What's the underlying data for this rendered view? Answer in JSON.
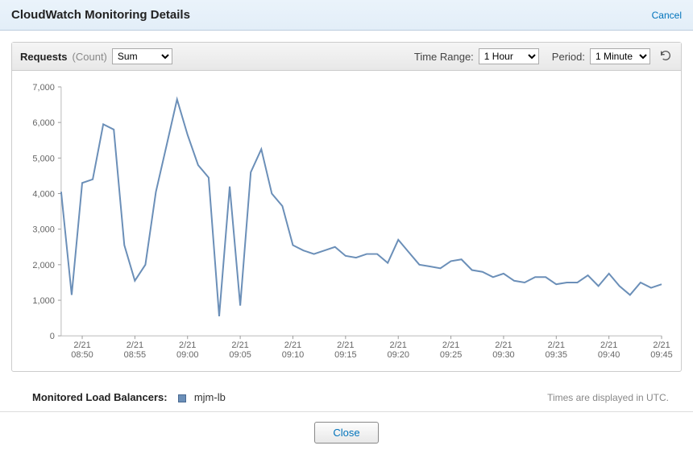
{
  "title": "CloudWatch Monitoring Details",
  "cancel_label": "Cancel",
  "metric": {
    "name": "Requests",
    "unit": "(Count)"
  },
  "toolbar": {
    "stat_selected": "Sum",
    "time_range_label": "Time Range:",
    "time_range_selected": "1 Hour",
    "period_label": "Period:",
    "period_selected": "1 Minute"
  },
  "footer": {
    "lb_label": "Monitored Load Balancers:",
    "lb_name": "mjm-lb",
    "tz_note": "Times are displayed in UTC."
  },
  "close_label": "Close",
  "chart_data": {
    "type": "line",
    "title": "Requests (Count) Sum",
    "xlabel": "",
    "ylabel": "",
    "ylim": [
      0,
      7000
    ],
    "y_ticks": [
      0,
      1000,
      2000,
      3000,
      4000,
      5000,
      6000,
      7000
    ],
    "x_tick_labels": [
      "2/21\n08:50",
      "2/21\n08:55",
      "2/21\n09:00",
      "2/21\n09:05",
      "2/21\n09:10",
      "2/21\n09:15",
      "2/21\n09:20",
      "2/21\n09:25",
      "2/21\n09:30",
      "2/21\n09:35",
      "2/21\n09:40",
      "2/21\n09:45"
    ],
    "x_tick_indices": [
      2,
      7,
      12,
      17,
      22,
      27,
      32,
      37,
      42,
      47,
      52,
      57
    ],
    "n_points": 58,
    "series": [
      {
        "name": "mjm-lb",
        "values": [
          4050,
          1150,
          4300,
          4400,
          5950,
          5800,
          2550,
          1550,
          2000,
          4050,
          5350,
          6650,
          5650,
          4800,
          4450,
          550,
          4200,
          850,
          4600,
          5250,
          4000,
          3650,
          2550,
          2400,
          2300,
          2400,
          2500,
          2250,
          2200,
          2300,
          2300,
          2050,
          2700,
          2350,
          2000,
          1950,
          1900,
          2100,
          2150,
          1850,
          1800,
          1650,
          1750,
          1550,
          1500,
          1650,
          1650,
          1450,
          1500,
          1500,
          1700,
          1400,
          1750,
          1400,
          1150,
          1500,
          1350,
          1450
        ]
      }
    ],
    "legend": [
      "mjm-lb"
    ]
  }
}
